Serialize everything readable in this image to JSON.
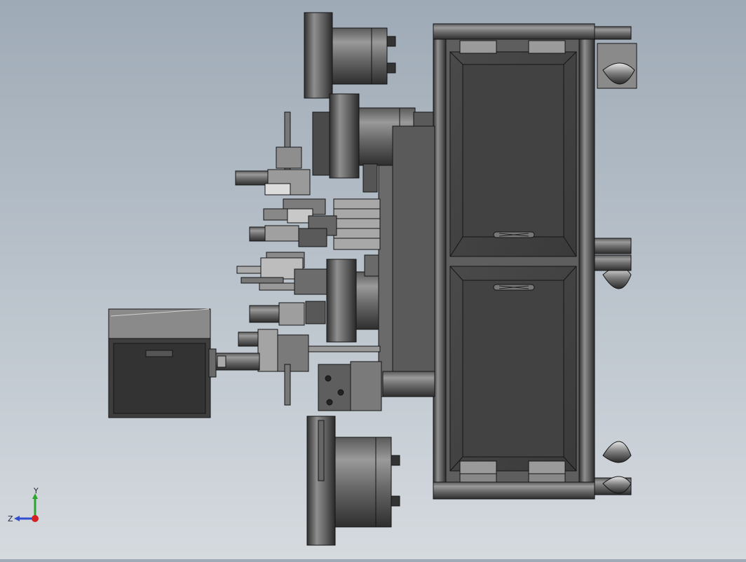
{
  "window": {
    "title": ""
  },
  "viewport": {
    "name": "cad-graphics-area",
    "background_top": "#9eaab6",
    "background_bottom": "#d5dadf"
  },
  "model": {
    "palette": {
      "dark": "#3d3d3d",
      "mid": "#6b6b6b",
      "light": "#a7a7a7",
      "line": "#1a1a1a"
    }
  },
  "triad": {
    "y_label": "Y",
    "z_label": "Z",
    "x_color": "#d42020",
    "y_color": "#2fa32f",
    "z_color": "#2f4fd0"
  }
}
